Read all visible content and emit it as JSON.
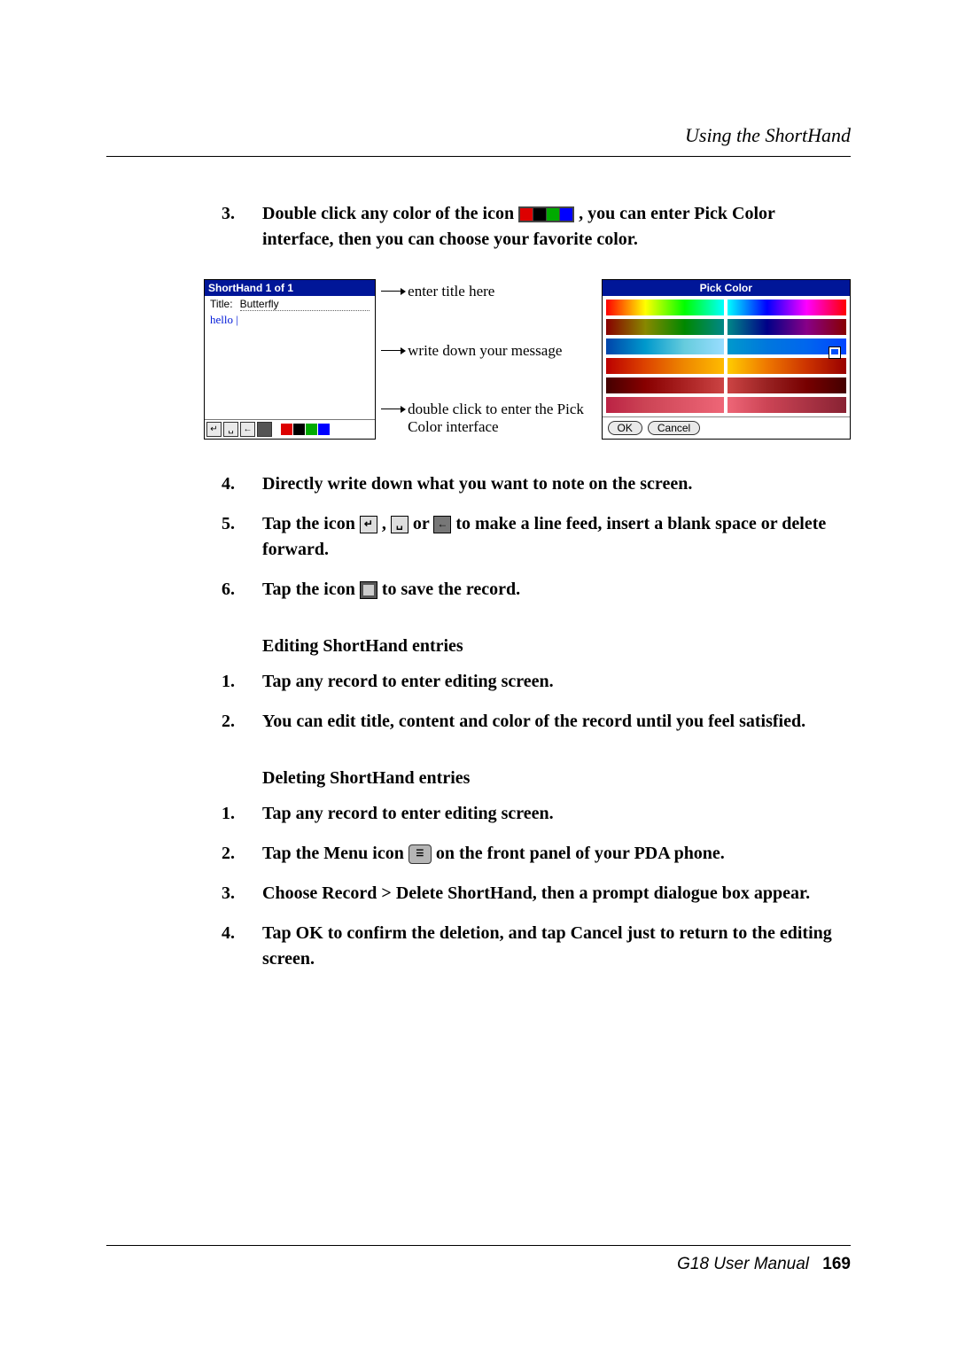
{
  "header": {
    "section": "Using the ShortHand"
  },
  "step3": {
    "num": "3.",
    "text_a": "Double click any color of the icon",
    "text_b": ", you can enter Pick Color interface, then you can choose your favorite color."
  },
  "figure": {
    "left_panel": {
      "topbar": "ShortHand 1 of 1",
      "title_label": "Title:",
      "title_value": "Butterfly",
      "body_text": "hello"
    },
    "callouts": {
      "c1": "enter title here",
      "c2": "write down your message",
      "c3": "double click to enter the Pick Color interface"
    },
    "pick_color": {
      "header": "Pick Color",
      "ok": "OK",
      "cancel": "Cancel"
    }
  },
  "step4": {
    "num": "4.",
    "text": "Directly write down what you want to note on the screen."
  },
  "step5": {
    "num": "5.",
    "text_a": "Tap the icon ",
    "comma": ", ",
    "or": " or ",
    "text_b": " to make a line feed, insert a blank space or delete forward."
  },
  "step6": {
    "num": "6.",
    "text_a": "Tap the icon ",
    "text_b": " to save the record."
  },
  "editing": {
    "title": "Editing ShortHand entries",
    "s1": {
      "num": "1.",
      "text": "Tap any record to enter editing screen."
    },
    "s2": {
      "num": "2.",
      "text": "You can edit title, content and color of the record until you feel satisfied."
    }
  },
  "deleting": {
    "title": "Deleting ShortHand entries",
    "s1": {
      "num": "1.",
      "text": "Tap any record to enter editing screen."
    },
    "s2": {
      "num": "2.",
      "text_a": "Tap the Menu icon ",
      "text_b": " on the front panel of your PDA phone."
    },
    "s3": {
      "num": "3.",
      "text": "Choose Record > Delete ShortHand, then a prompt dialogue box appear."
    },
    "s4": {
      "num": "4.",
      "text": "Tap OK to confirm the deletion, and tap Cancel just to return to the editing screen."
    }
  },
  "footer": {
    "manual": "G18 User Manual",
    "page": "169"
  },
  "icons": {
    "enter": "↵",
    "space": "␣",
    "back": "←",
    "menu": "☰"
  }
}
